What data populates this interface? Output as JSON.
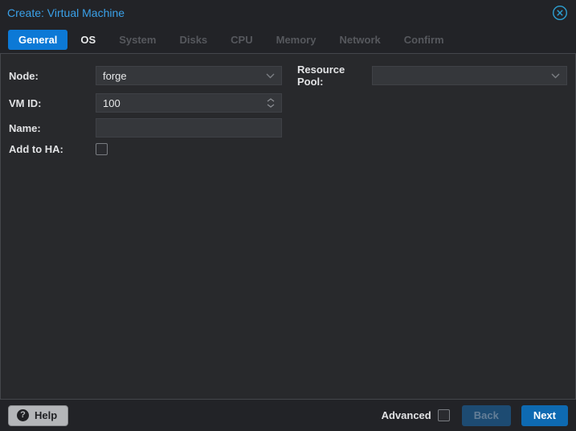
{
  "window": {
    "title": "Create: Virtual Machine"
  },
  "tabs": [
    {
      "label": "General",
      "state": "active"
    },
    {
      "label": "OS",
      "state": "enabled"
    },
    {
      "label": "System",
      "state": "disabled"
    },
    {
      "label": "Disks",
      "state": "disabled"
    },
    {
      "label": "CPU",
      "state": "disabled"
    },
    {
      "label": "Memory",
      "state": "disabled"
    },
    {
      "label": "Network",
      "state": "disabled"
    },
    {
      "label": "Confirm",
      "state": "disabled"
    }
  ],
  "form": {
    "node": {
      "label": "Node:",
      "value": "forge"
    },
    "vmid": {
      "label": "VM ID:",
      "value": "100"
    },
    "name": {
      "label": "Name:",
      "value": ""
    },
    "ha": {
      "label": "Add to HA:",
      "checked": false
    },
    "resource_pool": {
      "label": "Resource Pool:",
      "value": ""
    }
  },
  "footer": {
    "help": "Help",
    "help_icon_glyph": "?",
    "advanced": "Advanced",
    "advanced_checked": false,
    "back": "Back",
    "back_enabled": false,
    "next": "Next",
    "next_enabled": true
  },
  "icons": {
    "close": "circle-x-icon",
    "help": "question-circle-icon",
    "combo": "chevron-down-icon",
    "spinner": "chevron-up-down-icon"
  },
  "colors": {
    "title_text": "#3aa1e9",
    "active_tab_bg": "#0c79d6",
    "next_button_bg": "#0e6ab2",
    "back_button_bg": "#1d4b72",
    "close_icon": "#2da0d3",
    "header_bg": "#222327",
    "panel_bg": "#28292c",
    "field_bg": "#35373b",
    "help_button_bg": "#b4b6b9"
  }
}
